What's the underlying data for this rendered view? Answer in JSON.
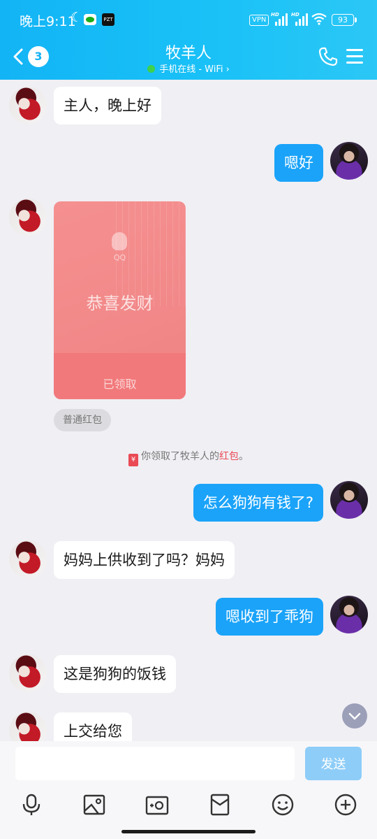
{
  "status_bar": {
    "time": "晚上9:11",
    "vpn": "VPN",
    "hd": "HD",
    "battery": "93"
  },
  "header": {
    "back_count": "3",
    "title": "牧羊人",
    "status": "手机在线 - WiFi",
    "status_chevron": "›"
  },
  "messages": {
    "m1": "主人，晚上好",
    "m2": "嗯好",
    "red_packet": {
      "logo": "QQ",
      "greeting": "恭喜发财",
      "status": "已领取",
      "type_tag": "普通红包"
    },
    "system": {
      "icon": "¥",
      "prefix": "你领取了牧羊人的",
      "highlight": "红包",
      "suffix": "。"
    },
    "m3": "怎么狗狗有钱了?",
    "m4": "妈妈上供收到了吗？妈妈",
    "m5": "嗯收到了乖狗",
    "m6": "这是狗狗的饭钱",
    "m7": "上交给您"
  },
  "input": {
    "placeholder": "",
    "send_label": "发送"
  },
  "toolbar": {
    "icons": [
      "microphone-icon",
      "image-icon",
      "camera-icon",
      "red-packet-icon",
      "emoji-icon",
      "plus-icon"
    ]
  },
  "colors": {
    "accent": "#13b4f5",
    "outgoing_bubble": "#1aa3f9",
    "red_packet": "#f08384"
  }
}
